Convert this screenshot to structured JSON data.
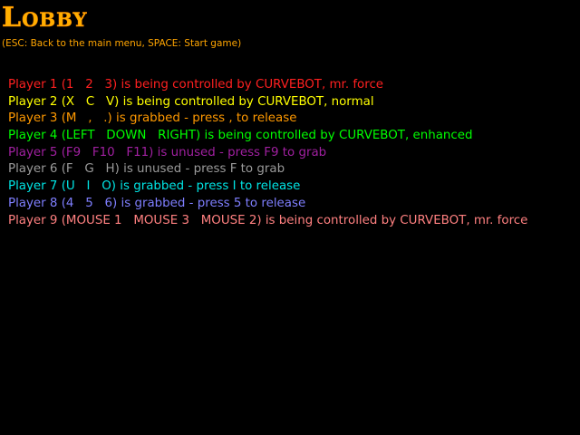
{
  "lobby": {
    "title": "Lobby",
    "hint": "(ESC: Back to the main menu, SPACE: Start game)"
  },
  "players": [
    {
      "text": "Player 1 (1   2   3) is being controlled by CURVEBOT, mr. force",
      "color": "#ff2020"
    },
    {
      "text": "Player 2 (X   C   V) is being controlled by CURVEBOT, normal",
      "color": "#ffff00"
    },
    {
      "text": "Player 3 (M   ,   .) is grabbed - press , to release",
      "color": "#ff9900"
    },
    {
      "text": "Player 4 (LEFT   DOWN   RIGHT) is being controlled by CURVEBOT, enhanced",
      "color": "#00ff00"
    },
    {
      "text": "Player 5 (F9   F10   F11) is unused - press F9 to grab",
      "color": "#a020a0"
    },
    {
      "text": "Player 6 (F   G   H) is unused - press F to grab",
      "color": "#9a9a9a"
    },
    {
      "text": "Player 7 (U   I   O) is grabbed - press I to release",
      "color": "#00e5e5"
    },
    {
      "text": "Player 8 (4   5   6) is grabbed - press 5 to release",
      "color": "#7f7fff"
    },
    {
      "text": "Player 9 (MOUSE 1   MOUSE 3   MOUSE 2) is being controlled by CURVEBOT, mr. force",
      "color": "#ff8080"
    }
  ]
}
